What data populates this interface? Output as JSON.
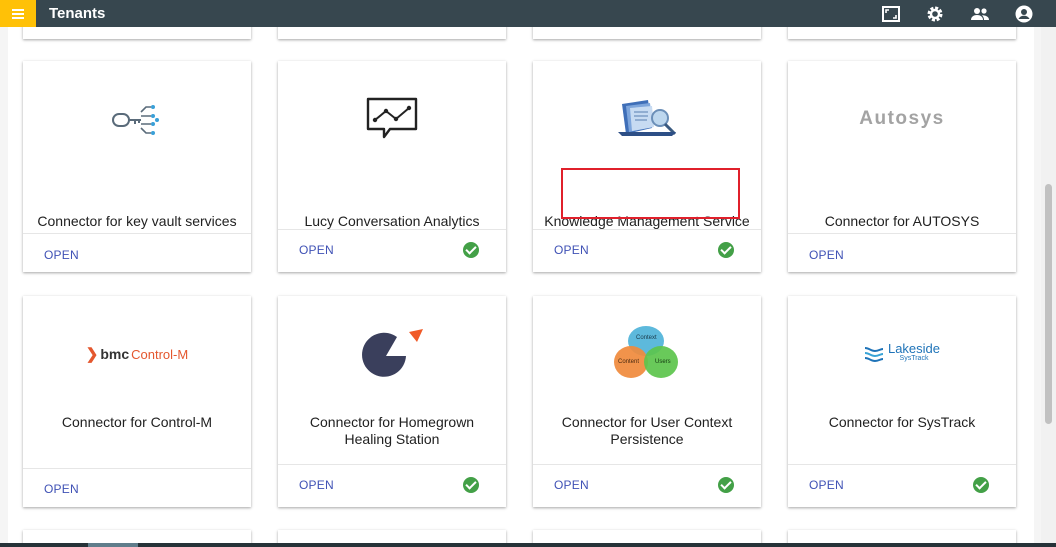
{
  "header": {
    "title": "Tenants",
    "icons": [
      "fullscreen-icon",
      "settings-icon",
      "people-icon",
      "account-icon"
    ]
  },
  "colors": {
    "topbar": "#37474f",
    "menu_accent": "#ffc107",
    "open_link": "#3f51b5",
    "check": "#43a047",
    "highlight": "#e0202b"
  },
  "cards": [
    {
      "title": "Connector for key vault services",
      "open_label": "OPEN",
      "logo": "key-vault-icon",
      "verified": false
    },
    {
      "title": "Lucy Conversation Analytics",
      "open_label": "OPEN",
      "logo": "analytics-chart-icon",
      "verified": true
    },
    {
      "title": "Knowledge Management Service",
      "open_label": "OPEN",
      "logo": "folders-magnifier-icon",
      "verified": true
    },
    {
      "title": "Connector for AUTOSYS",
      "open_label": "OPEN",
      "logo": "autosys-logo",
      "logo_text": "Autosys",
      "verified": false
    },
    {
      "title": "Connector for Control-M",
      "open_label": "OPEN",
      "logo": "bmc-control-m-logo",
      "logo_text": "bmc",
      "logo_text2": "Control-M",
      "verified": false
    },
    {
      "title": "Connector for Homegrown Healing Station",
      "open_label": "OPEN",
      "logo": "pacman-arrow-icon",
      "verified": true
    },
    {
      "title": "Connector for User Context Persistence",
      "open_label": "OPEN",
      "logo": "venn-circles-icon",
      "logo_labels": [
        "Context",
        "Content",
        "Users"
      ],
      "verified": true
    },
    {
      "title": "Connector for SysTrack",
      "open_label": "OPEN",
      "logo": "lakeside-systrack-logo",
      "logo_text": "Lakeside",
      "logo_text2": "SysTrack",
      "verified": true
    }
  ]
}
